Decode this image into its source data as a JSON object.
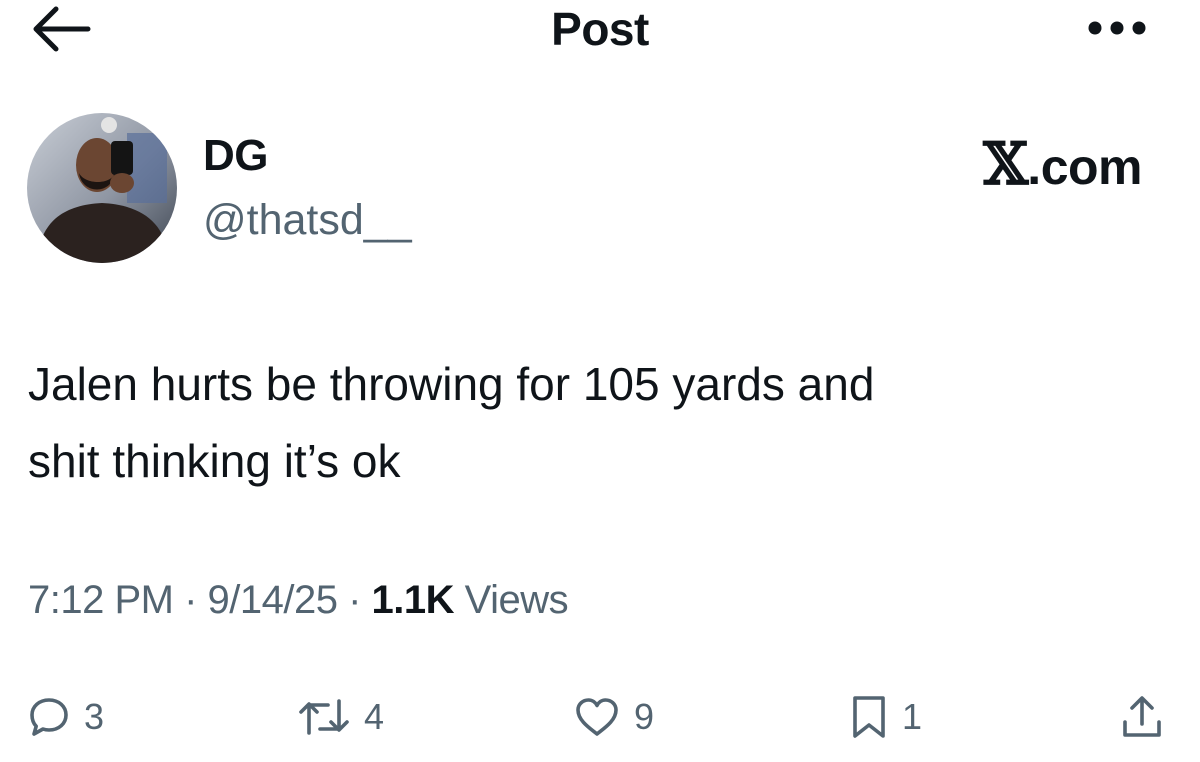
{
  "header": {
    "title": "Post",
    "back_icon": "arrow-left-icon",
    "more_icon": "more-horizontal-icon"
  },
  "author": {
    "display_name": "DG",
    "handle": "@thatsd__"
  },
  "site_label": {
    "mark": "𝕏",
    "text": ".com"
  },
  "post": {
    "text": "Jalen hurts be throwing for 105 yards and\nshit thinking it’s ok",
    "time": "7:12 PM",
    "separator": " · ",
    "date": "9/14/25",
    "views_count": "1.1K",
    "views_label": " Views"
  },
  "actions": {
    "replies": "3",
    "reposts": "4",
    "likes": "9",
    "bookmarks": "1"
  },
  "colors": {
    "text_primary": "#0f1419",
    "text_secondary": "#536471",
    "background": "#ffffff"
  }
}
